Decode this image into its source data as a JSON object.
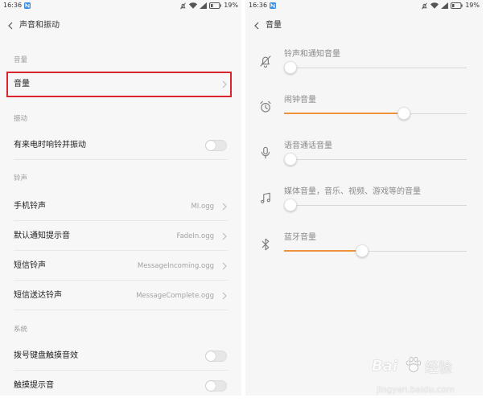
{
  "left_screen": {
    "status_bar": {
      "time": "16:36",
      "battery": "19%",
      "icons": [
        "notification-icon",
        "mute-icon",
        "wifi-icon",
        "signal-icon",
        "battery-icon"
      ]
    },
    "header": {
      "back_icon": "chevron-left-icon",
      "title": "声音和振动"
    },
    "sections": [
      {
        "label": "音量",
        "items": [
          {
            "label": "音量",
            "highlighted": true,
            "trailing_icon": "chevron-right-icon"
          }
        ]
      },
      {
        "label": "振动",
        "items": [
          {
            "label": "有来电时响铃并振动",
            "toggle_on": false
          }
        ]
      },
      {
        "label": "铃声",
        "items": [
          {
            "label": "手机铃声",
            "value": "MI.ogg",
            "trailing_icon": "chevron-right-icon"
          },
          {
            "label": "默认通知提示音",
            "value": "FadeIn.ogg",
            "trailing_icon": "chevron-right-icon"
          },
          {
            "label": "短信铃声",
            "value": "MessageIncoming.ogg",
            "trailing_icon": "chevron-right-icon"
          },
          {
            "label": "短信送达铃声",
            "value": "MessageComplete.ogg",
            "trailing_icon": "chevron-right-icon"
          }
        ]
      },
      {
        "label": "系统",
        "items": [
          {
            "label": "拨号键盘触摸音效",
            "toggle_on": false
          },
          {
            "label": "触摸提示音",
            "toggle_on": false
          }
        ]
      }
    ]
  },
  "right_screen": {
    "status_bar": {
      "time": "16:36",
      "battery": "19%",
      "icons": [
        "notification-icon",
        "mute-icon",
        "wifi-icon",
        "signal-icon",
        "battery-icon"
      ]
    },
    "header": {
      "back_icon": "chevron-left-icon",
      "title": "音量"
    },
    "volume_items": [
      {
        "icon": "bell-off-icon",
        "label": "铃声和通知音量",
        "level": 0
      },
      {
        "icon": "alarm-clock-icon",
        "label": "闹钟音量",
        "level": 0.67
      },
      {
        "icon": "microphone-icon",
        "label": "语音通话音量",
        "level": 0
      },
      {
        "icon": "music-note-icon",
        "label": "媒体音量，音乐、视频、游戏等的音量",
        "level": 0
      },
      {
        "icon": "bluetooth-icon",
        "label": "蓝牙音量",
        "level": 0.42
      }
    ]
  },
  "colors": {
    "highlight_border": "#d7262e",
    "slider_fill": "#f0913c",
    "notification_badge": "#3d8fe0"
  },
  "watermark": {
    "brand_left": "Bai",
    "brand_right": "经验",
    "url": "jingyan.baidu.com"
  }
}
